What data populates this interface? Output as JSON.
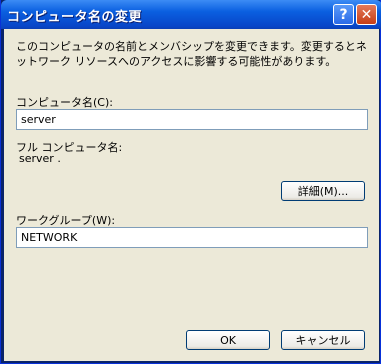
{
  "window": {
    "title": "コンピュータ名の変更",
    "help_label": "?",
    "close_label": "✕"
  },
  "description": "このコンピュータの名前とメンバシップを変更できます。変更するとネットワーク リソースへのアクセスに影響する可能性があります。",
  "computer_name": {
    "label": "コンピュータ名(C):",
    "value": "server"
  },
  "full_name": {
    "label": "フル コンピュータ名:",
    "value": "server ."
  },
  "details_button": "詳細(M)...",
  "workgroup": {
    "label": "ワークグループ(W):",
    "value": "NETWORK"
  },
  "ok_button": "OK",
  "cancel_button": "キャンセル"
}
